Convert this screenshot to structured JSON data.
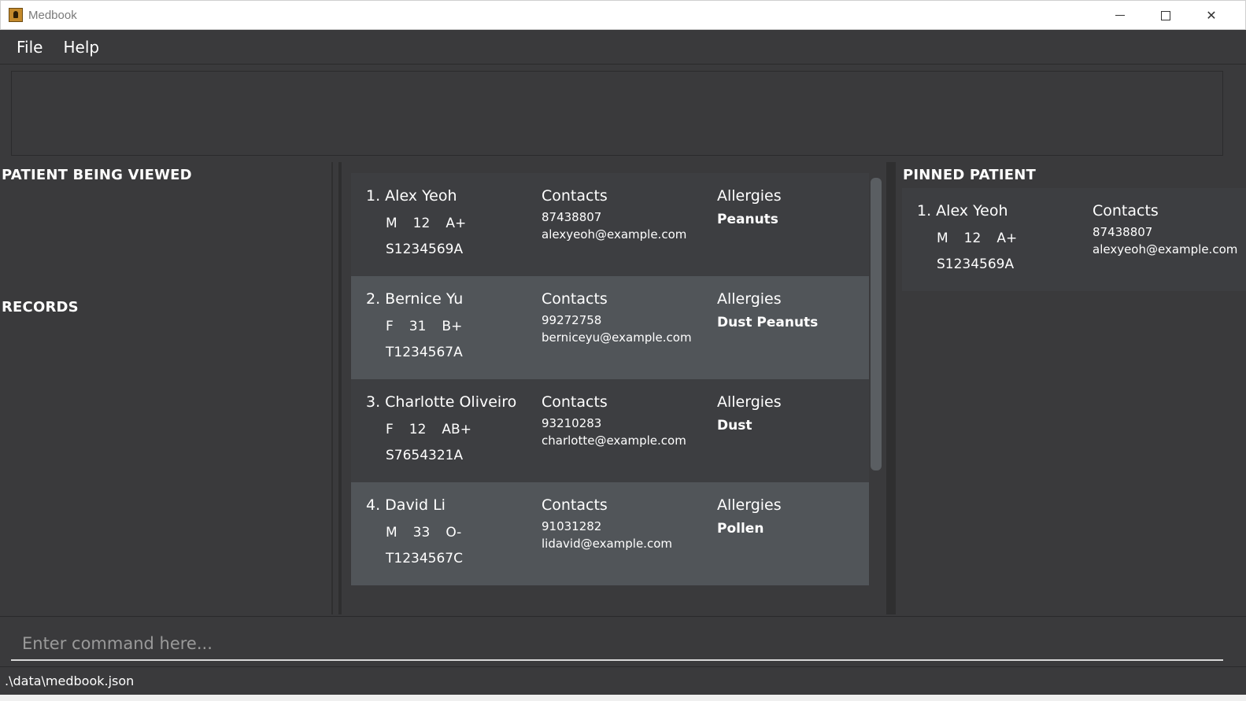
{
  "window": {
    "title": "Medbook"
  },
  "menu": {
    "file": "File",
    "help": "Help"
  },
  "left_panel": {
    "patient_title": "PATIENT BEING VIEWED",
    "records_title": "RECORDS"
  },
  "patients": [
    {
      "index_name": "1. Alex Yeoh",
      "gender": "M",
      "age": "12",
      "blood": "A+",
      "nric": "S1234569A",
      "contacts_label": "Contacts",
      "phone": "87438807",
      "email": "alexyeoh@example.com",
      "allergies_label": "Allergies",
      "allergies": "Peanuts"
    },
    {
      "index_name": "2. Bernice Yu",
      "gender": "F",
      "age": "31",
      "blood": "B+",
      "nric": "T1234567A",
      "contacts_label": "Contacts",
      "phone": "99272758",
      "email": "berniceyu@example.com",
      "allergies_label": "Allergies",
      "allergies": "Dust Peanuts"
    },
    {
      "index_name": "3. Charlotte Oliveiro",
      "gender": "F",
      "age": "12",
      "blood": "AB+",
      "nric": "S7654321A",
      "contacts_label": "Contacts",
      "phone": "93210283",
      "email": "charlotte@example.com",
      "allergies_label": "Allergies",
      "allergies": "Dust"
    },
    {
      "index_name": "4. David Li",
      "gender": "M",
      "age": "33",
      "blood": "O-",
      "nric": "T1234567C",
      "contacts_label": "Contacts",
      "phone": "91031282",
      "email": "lidavid@example.com",
      "allergies_label": "Allergies",
      "allergies": "Pollen"
    }
  ],
  "pinned": {
    "title": "PINNED PATIENT",
    "index_name": "1. Alex Yeoh",
    "gender": "M",
    "age": "12",
    "blood": "A+",
    "nric": "S1234569A",
    "contacts_label": "Contacts",
    "phone": "87438807",
    "email": "alexyeoh@example.com"
  },
  "command": {
    "placeholder": "Enter command here..."
  },
  "status": {
    "path": ".\\data\\medbook.json"
  },
  "colors": {
    "background": "#3a3a3c",
    "card_odd": "#3d3e41",
    "card_even": "#515559"
  }
}
